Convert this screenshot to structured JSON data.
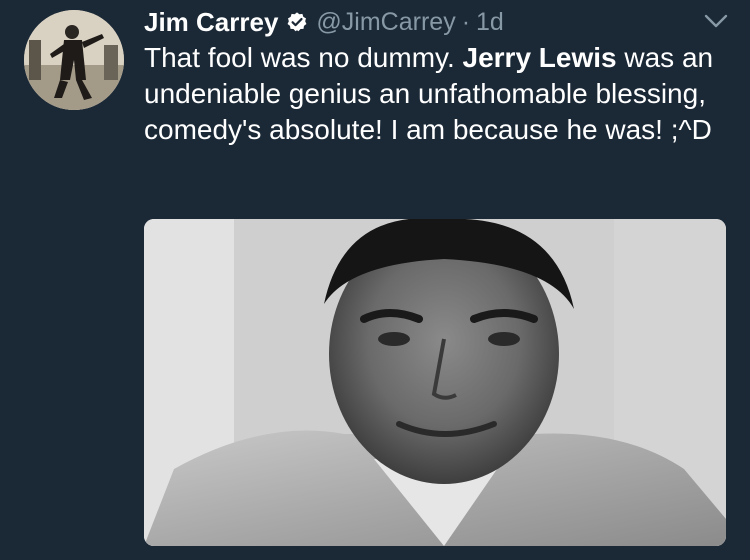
{
  "tweet": {
    "display_name": "Jim Carrey",
    "handle": "@JimCarrey",
    "separator": "·",
    "time": "1d",
    "text_part1": "That fool was no dummy. ",
    "text_bold": "Jerry Lewis",
    "text_part2": " was an undeniable genius an unfathomable blessing, comedy's absolute! I am because he was! ;^D"
  },
  "icons": {
    "verified": "verified-badge-icon",
    "caret": "chevron-down-icon"
  },
  "colors": {
    "background": "#1b2836",
    "name": "#ffffff",
    "secondary": "#8899a6",
    "verified": "#ffffff"
  }
}
